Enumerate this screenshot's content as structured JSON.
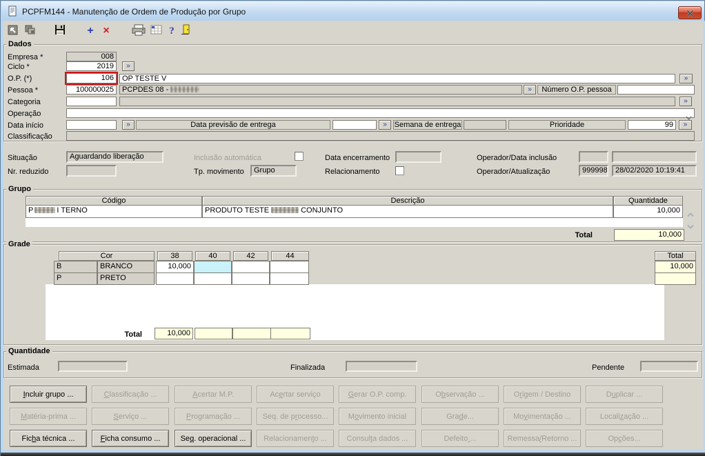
{
  "window": {
    "title": "PCPFM144 - Manutenção de Ordem de Produção por Grupo"
  },
  "toolbar": {
    "icons": [
      "goto-record",
      "cascade-windows",
      "save",
      "add",
      "delete",
      "print",
      "grid",
      "help",
      "exit"
    ],
    "add_glyph": "+",
    "delete_glyph": "×",
    "help_glyph": "?"
  },
  "colors": {
    "focus_red": "#cd1616",
    "selected_cell": "#c9f2fb",
    "total_yellow": "#ffffe1",
    "titlebar_blue": "#bed8f0"
  },
  "dados": {
    "legend": "Dados",
    "empresa_label": "Empresa *",
    "empresa_value": "008",
    "ciclo_label": "Ciclo *",
    "ciclo_value": "2019",
    "op_label": "O.P. (*)",
    "op_value": "106",
    "op_desc": "OP TESTE V",
    "pessoa_label": "Pessoa *",
    "pessoa_value": "100000025",
    "pessoa_desc_prefix": "PCPDES 08 - ",
    "numero_op_label": "Número O.P. pessoa",
    "categoria_label": "Categoria",
    "operacao_label": "Operação",
    "data_inicio_label": "Data início",
    "previsao_label": "Data previsão de entrega",
    "semana_label": "Semana de entrega",
    "prioridade_label": "Prioridade",
    "prioridade_value": "99",
    "classificacao_label": "Classificação",
    "more_glyph": "»"
  },
  "situacao": {
    "situacao_label": "Situação",
    "situacao_value": "Aguardando liberação",
    "nr_reduzido_label": "Nr. reduzido",
    "inclusao_label": "Inclusão automática",
    "tp_movimento_label": "Tp. movimento",
    "tp_movimento_value": "Grupo",
    "data_encerramento_label": "Data encerramento",
    "relacionamento_label": "Relacionamento",
    "operador_inclusao_label": "Operador/Data inclusão",
    "operador_atualizacao_label": "Operador/Atualização",
    "operador_value": "999998",
    "atualizacao_value": "28/02/2020 10:19:41"
  },
  "grupo": {
    "legend": "Grupo",
    "col_codigo": "Código",
    "col_descricao": "Descrição",
    "col_quantidade": "Quantidade",
    "row_codigo_prefix": "P",
    "row_codigo_suffix": "I TERNO",
    "row_descricao_prefix": "PRODUTO TESTE",
    "row_descricao_suffix": "CONJUNTO",
    "row_quantidade": "10,000",
    "total_label": "Total",
    "total_value": "10,000"
  },
  "grade": {
    "legend": "Grade",
    "col_cor": "Cor",
    "sizes": [
      "38",
      "40",
      "42",
      "44"
    ],
    "col_total": "Total",
    "rows": [
      {
        "code": "B",
        "name": "BRANCO",
        "values": [
          "10,000",
          "",
          "",
          ""
        ],
        "total": "10,000"
      },
      {
        "code": "P",
        "name": "PRETO",
        "values": [
          "",
          "",
          "",
          ""
        ],
        "total": ""
      }
    ],
    "total_label": "Total",
    "col_totals": [
      "10,000",
      "",
      "",
      ""
    ]
  },
  "quantidade": {
    "legend": "Quantidade",
    "estimada_label": "Estimada",
    "finalizada_label": "Finalizada",
    "pendente_label": "Pendente"
  },
  "buttons": [
    [
      {
        "label": "Incluir grupo ...",
        "u": 0,
        "enabled": true
      },
      {
        "label": "Classificação ...",
        "u": 0,
        "enabled": false
      },
      {
        "label": "Acertar M.P.",
        "u": 0,
        "enabled": false
      },
      {
        "label": "Acertar serviço",
        "u": 2,
        "enabled": false
      },
      {
        "label": "Gerar O.P. comp.",
        "u": 0,
        "enabled": false
      },
      {
        "label": "Observação ...",
        "u": 1,
        "enabled": false
      },
      {
        "label": "Origem / Destino",
        "u": 1,
        "enabled": false
      },
      {
        "label": "Duplicar ...",
        "u": 1,
        "enabled": false
      }
    ],
    [
      {
        "label": "Matéria-prima ...",
        "u": 0,
        "enabled": false
      },
      {
        "label": "Serviço ...",
        "u": 0,
        "enabled": false
      },
      {
        "label": "Programação ...",
        "u": 0,
        "enabled": false
      },
      {
        "label": "Seq. de processo...",
        "u": 9,
        "enabled": false
      },
      {
        "label": "Movimento inicial",
        "u": 1,
        "enabled": false
      },
      {
        "label": "Grade...",
        "u": 3,
        "enabled": false
      },
      {
        "label": "Movimentação ...",
        "u": 2,
        "enabled": false
      },
      {
        "label": "Localização ...",
        "u": 6,
        "enabled": false
      }
    ],
    [
      {
        "label": "Ficha técnica ...",
        "u": 3,
        "enabled": true
      },
      {
        "label": "Ficha consumo ...",
        "u": 0,
        "enabled": true
      },
      {
        "label": "Seq. operacional ...",
        "u": 2,
        "enabled": true
      },
      {
        "label": "Relacionamento ...",
        "u": 12,
        "enabled": false
      },
      {
        "label": "Consulta dados ...",
        "u": 6,
        "enabled": false
      },
      {
        "label": "Defeito ...",
        "u": 7,
        "enabled": false
      },
      {
        "label": "Remessa/Retorno ...",
        "u": 7,
        "enabled": false
      },
      {
        "label": "Opções...",
        "u": 2,
        "enabled": false
      }
    ]
  ]
}
